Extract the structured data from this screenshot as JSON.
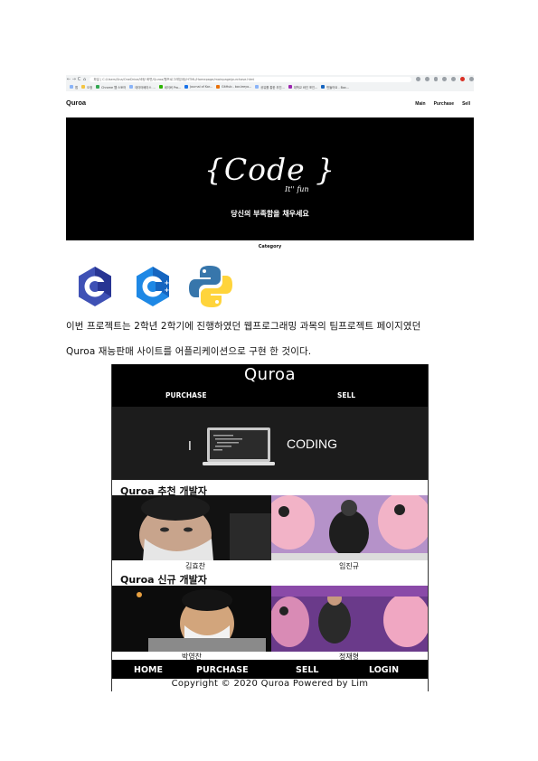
{
  "browser": {
    "nav_buttons": [
      "←",
      "→",
      "C",
      "⌂"
    ],
    "address": "파일 | C:/Users/Sna/OneDrive/바탕 화면/Quroa/웹프로그래밍/팀/HTML/Homepage/mainpage/purchase.html",
    "bookmarks": [
      "앱",
      "오정",
      "Chrome 웹 스토어",
      "데이터베이스 ...",
      "네이버 Pro...",
      "Journal of Kor...",
      "GitHub - bor-leeyo...",
      "공유를 통한 추진...",
      "대학교 바인 포인...",
      "만들어요 - Box..."
    ]
  },
  "site": {
    "logo": "Quroa",
    "nav": [
      "Main",
      "Purchase",
      "Sell"
    ],
    "hero_title": "{Code }",
    "hero_sub": "It'' fun",
    "hero_slogan": "당신의 부족함을 채우세요",
    "category": "Category"
  },
  "logos": [
    "c-logo-icon",
    "cpp-logo-icon",
    "python-logo-icon"
  ],
  "paragraph": {
    "line1": "이번  프로젝트는  2학년  2학기에  진행하였던  웹프로그래밍  과목의  팀프로젝트  페이지였던",
    "line2": "Quroa  재능판매  사이트를  어플리케이션으로  구현  한  것이다."
  },
  "app": {
    "title": "Quroa",
    "tabs": [
      "PURCHASE",
      "SELL"
    ],
    "banner_i": "I",
    "banner_word": "CODING",
    "section1_title": "Quroa 추천 개발자",
    "section1_names": [
      "김효찬",
      "임진규"
    ],
    "section2_title": "Quroa 신규 개발자",
    "section2_names": [
      "박영찬",
      "정재형"
    ],
    "bottom_nav": [
      "HOME",
      "PURCHASE",
      "SELL",
      "LOGIN"
    ],
    "copyright": "Copyright © 2020 Quroa Powered by Lim"
  },
  "colors": {
    "hero_bg": "#000000",
    "c_logo": "#3949ab",
    "cpp_logo": "#1565c0",
    "python_blue": "#3776ab",
    "python_yellow": "#ffd43b"
  }
}
